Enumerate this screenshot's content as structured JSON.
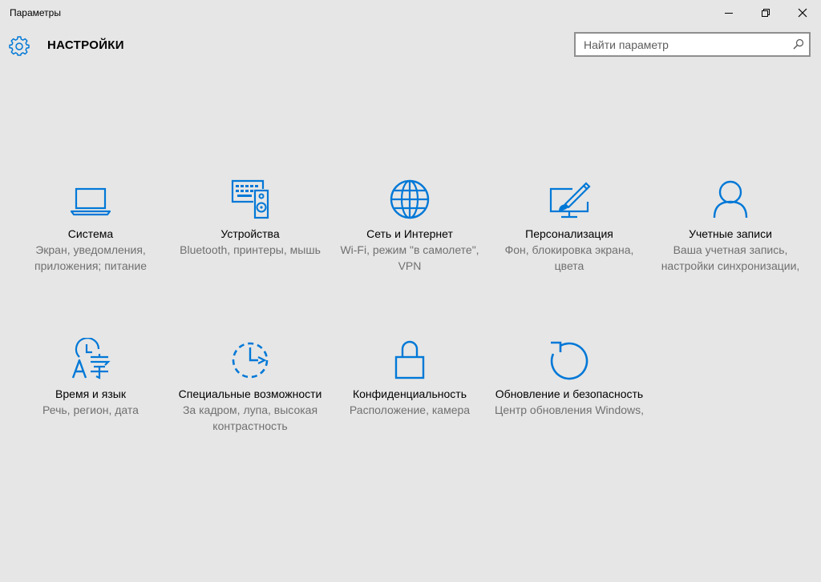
{
  "window": {
    "title": "Параметры",
    "controls": {
      "minimize": "minimize-icon",
      "maximize": "restore-icon",
      "close": "close-icon"
    }
  },
  "header": {
    "title": "НАСТРОЙКИ",
    "icon": "gear-icon",
    "search": {
      "placeholder": "Найти параметр",
      "value": "",
      "icon": "search-icon"
    }
  },
  "colors": {
    "accent": "#0078d7",
    "background": "#e6e6e6",
    "description": "#707070"
  },
  "tiles": [
    {
      "id": "system",
      "icon": "laptop-icon",
      "title": "Система",
      "description": "Экран, уведомления, приложения; питание"
    },
    {
      "id": "devices",
      "icon": "devices-icon",
      "title": "Устройства",
      "description": "Bluetooth, принтеры, мышь"
    },
    {
      "id": "network",
      "icon": "globe-icon",
      "title": "Сеть и Интернет",
      "description": "Wi-Fi, режим \"в самолете\", VPN"
    },
    {
      "id": "personalization",
      "icon": "personalization-icon",
      "title": "Персонализация",
      "description": "Фон, блокировка экрана, цвета"
    },
    {
      "id": "accounts",
      "icon": "person-icon",
      "title": "Учетные записи",
      "description": "Ваша учетная запись, настройки синхронизации,"
    },
    {
      "id": "time-language",
      "icon": "time-language-icon",
      "title": "Время и язык",
      "description": "Речь, регион, дата"
    },
    {
      "id": "ease-of-access",
      "icon": "ease-of-access-icon",
      "title": "Специальные возможности",
      "description": "За кадром, лупа, высокая контрастность"
    },
    {
      "id": "privacy",
      "icon": "lock-icon",
      "title": "Конфиденциальность",
      "description": "Расположение, камера"
    },
    {
      "id": "update",
      "icon": "update-icon",
      "title": "Обновление и безопасность",
      "description": "Центр обновления Windows,"
    }
  ]
}
